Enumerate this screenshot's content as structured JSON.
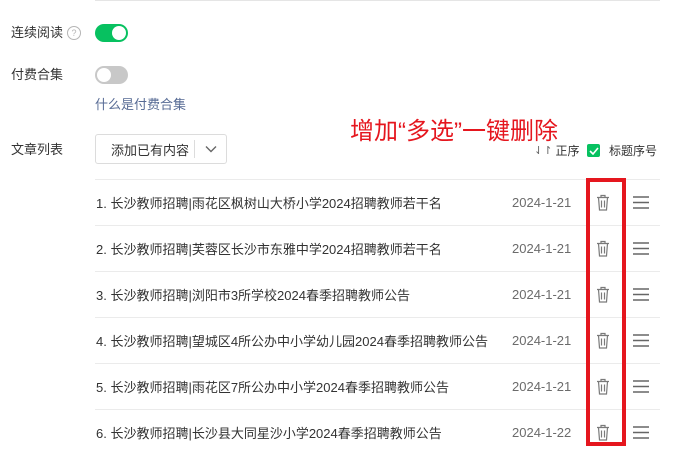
{
  "settings": {
    "continuous_read": {
      "label": "连续阅读",
      "help": "?",
      "enabled": true
    },
    "paid_collection": {
      "label": "付费合集",
      "enabled": false,
      "help_link": "什么是付费合集"
    },
    "article_list_label": "文章列表"
  },
  "toolbar": {
    "add_button_label": "添加已有内容",
    "sort_icon": "⇃↾",
    "sort_label": "正序",
    "title_number_label": "标题序号",
    "title_number_checked": true
  },
  "annotation": {
    "text": "增加“多选”一键删除",
    "color": "#e5161e"
  },
  "articles": [
    {
      "title": "1. 长沙教师招聘|雨花区枫树山大桥小学2024招聘教师若干名",
      "date": "2024-1-21"
    },
    {
      "title": "2. 长沙教师招聘|芙蓉区长沙市东雅中学2024招聘教师若干名",
      "date": "2024-1-21"
    },
    {
      "title": "3. 长沙教师招聘|浏阳市3所学校2024春季招聘教师公告",
      "date": "2024-1-21"
    },
    {
      "title": "4. 长沙教师招聘|望城区4所公办中小学幼儿园2024春季招聘教师公告",
      "date": "2024-1-21"
    },
    {
      "title": "5. 长沙教师招聘|雨花区7所公办中小学2024春季招聘教师公告",
      "date": "2024-1-21"
    },
    {
      "title": "6. 长沙教师招聘|长沙县大同星沙小学2024春季招聘教师公告",
      "date": "2024-1-22"
    }
  ],
  "icons": {
    "row_delete": "trash-icon",
    "row_drag": "drag-handle-icon",
    "dropdown": "chevron-down-icon",
    "checkbox": "checkmark-icon"
  },
  "colors": {
    "toggle_on": "#07c160",
    "toggle_off": "#c8c8c8",
    "link": "#576b95",
    "annotation_red": "#e5161e"
  }
}
